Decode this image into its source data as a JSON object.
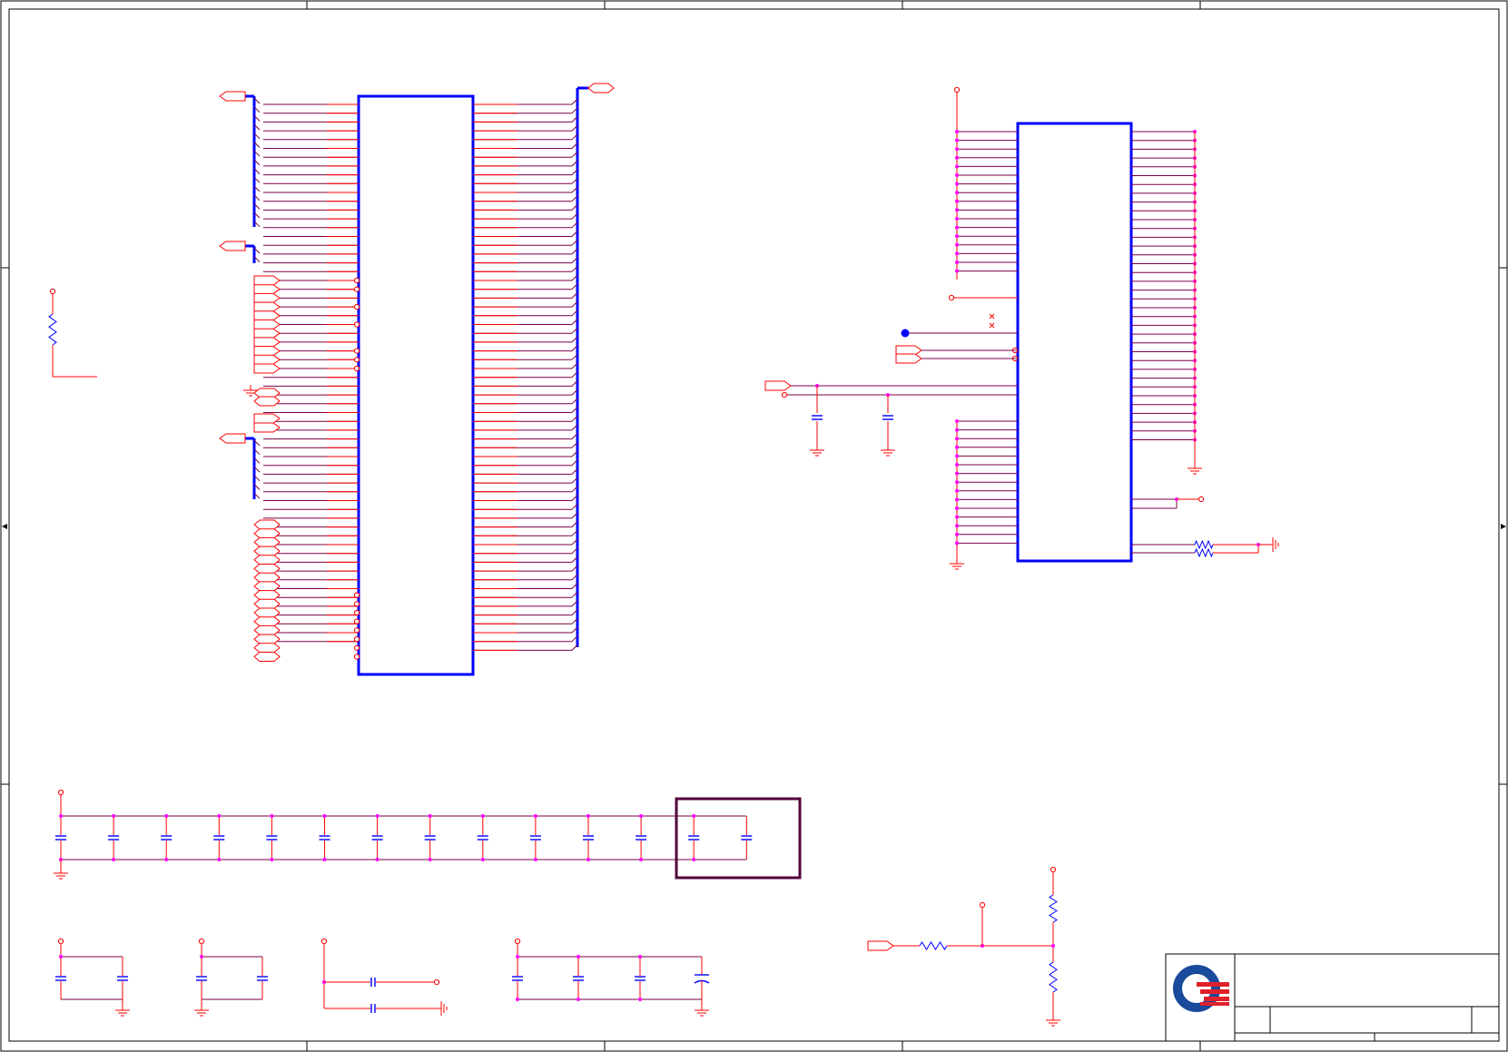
{
  "diagram": {
    "type": "electrical-schematic",
    "colors": {
      "wire": "#ff0000",
      "net": "#7a0044",
      "bus": "#0000ff",
      "part_outline": "#0000ff",
      "junction": "#ff00ff",
      "border": "#000000",
      "highlight_box": "#50003c",
      "logo_blue": "#1a4a9c",
      "logo_red": "#e0202a"
    },
    "parts": {
      "main_ic": "large-ic-with-bus-connections",
      "secondary_ic": "memory-ic",
      "decoupling_row_count": 14,
      "title_block": "company-title-block"
    },
    "logo": {
      "name": "company-logo-q"
    }
  }
}
